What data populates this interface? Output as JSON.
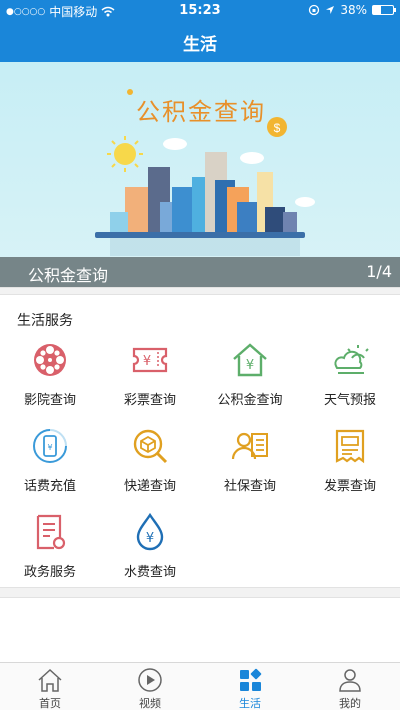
{
  "status": {
    "carrier": "中国移动",
    "time": "15:23",
    "battery": "38%",
    "battery_level": 0.38
  },
  "nav": {
    "title": "生活"
  },
  "banner": {
    "title": "公积金查询",
    "caption": "公积金查询",
    "pager": "1/4"
  },
  "section": {
    "title": "生活服务"
  },
  "services": [
    {
      "label": "影院查询",
      "icon": "film-reel-icon"
    },
    {
      "label": "彩票查询",
      "icon": "lottery-ticket-icon"
    },
    {
      "label": "公积金查询",
      "icon": "house-fund-icon"
    },
    {
      "label": "天气预报",
      "icon": "weather-icon"
    },
    {
      "label": "话费充值",
      "icon": "phone-recharge-icon"
    },
    {
      "label": "快递查询",
      "icon": "package-search-icon"
    },
    {
      "label": "社保查询",
      "icon": "social-security-card-icon"
    },
    {
      "label": "发票查询",
      "icon": "invoice-icon"
    },
    {
      "label": "政务服务",
      "icon": "government-document-icon"
    },
    {
      "label": "水费查询",
      "icon": "water-drop-icon"
    }
  ],
  "tabs": [
    {
      "label": "首页",
      "icon": "home-icon"
    },
    {
      "label": "视频",
      "icon": "play-icon"
    },
    {
      "label": "生活",
      "icon": "grid-apps-icon",
      "active": true
    },
    {
      "label": "我的",
      "icon": "user-icon"
    }
  ],
  "colors": {
    "accent": "#1a86d9",
    "banner_title": "#e8902a"
  }
}
